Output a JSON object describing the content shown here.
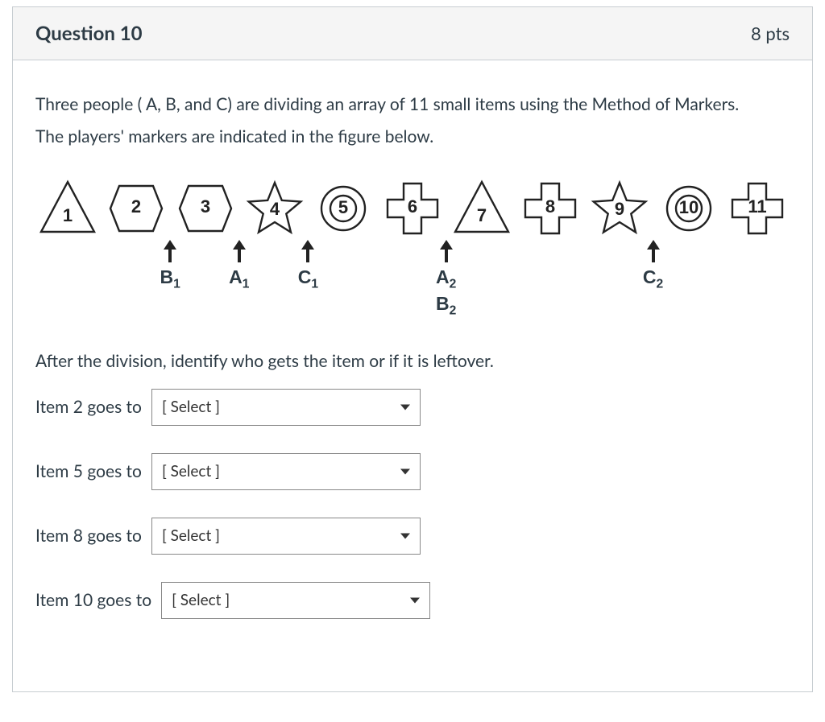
{
  "header": {
    "title": "Question 10",
    "points": "8 pts"
  },
  "prompt": {
    "line1": "Three people ( A, B, and C) are dividing an array of 11 small items using the Method of Markers.",
    "line2": "The players' markers are indicated in the figure below."
  },
  "after_text": "After the division, identify who gets the item or if it is leftover.",
  "items": [
    {
      "n": "1",
      "shape": "triangle",
      "markers": []
    },
    {
      "n": "2",
      "shape": "hexagon",
      "markers": []
    },
    {
      "n": "3",
      "shape": "hexagon",
      "markers": [
        {
          "txt": "B",
          "sub": "1"
        }
      ]
    },
    {
      "n": "4",
      "shape": "star",
      "markers": [
        {
          "txt": "A",
          "sub": "1"
        }
      ]
    },
    {
      "n": "5",
      "shape": "dblcircle",
      "markers": [
        {
          "txt": "C",
          "sub": "1"
        }
      ]
    },
    {
      "n": "6",
      "shape": "cross",
      "markers": []
    },
    {
      "n": "7",
      "shape": "triangle",
      "markers": [
        {
          "txt": "A",
          "sub": "2"
        },
        {
          "txt": "B",
          "sub": "2"
        }
      ]
    },
    {
      "n": "8",
      "shape": "cross",
      "markers": []
    },
    {
      "n": "9",
      "shape": "star",
      "markers": []
    },
    {
      "n": "10",
      "shape": "dblcircle",
      "markers": [
        {
          "txt": "C",
          "sub": "2"
        }
      ]
    },
    {
      "n": "11",
      "shape": "cross",
      "markers": []
    }
  ],
  "questions": [
    {
      "label": "Item 2 goes to",
      "placeholder": "[ Select ]"
    },
    {
      "label": "Item 5 goes to",
      "placeholder": "[ Select ]"
    },
    {
      "label": "Item 8 goes to",
      "placeholder": "[ Select ]"
    },
    {
      "label": "Item 10 goes to",
      "placeholder": "[ Select ]"
    }
  ]
}
